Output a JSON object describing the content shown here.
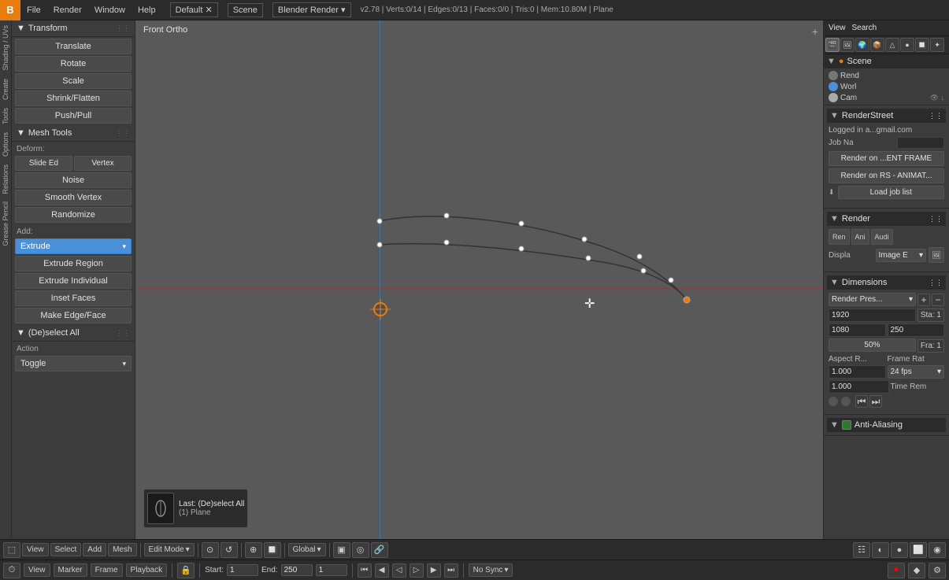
{
  "topbar": {
    "logo": "B",
    "menus": [
      "File",
      "Render",
      "Window",
      "Help"
    ],
    "workspace_label": "Default",
    "scene_label": "Scene",
    "renderer_label": "Blender Render",
    "info": "v2.78 | Verts:0/14 | Edges:0/13 | Faces:0/0 | Tris:0 | Mem:10.80M | Plane"
  },
  "viewport": {
    "label": "Front Ortho"
  },
  "left_sidebar": {
    "transform_header": "Transform",
    "transform_buttons": [
      "Translate",
      "Rotate",
      "Scale",
      "Shrink/Flatten",
      "Push/Pull"
    ],
    "mesh_tools_header": "Mesh Tools",
    "deform_label": "Deform:",
    "deform_buttons_row": [
      "Slide Ed",
      "Vertex"
    ],
    "noise_btn": "Noise",
    "smooth_vertex_btn": "Smooth Vertex",
    "randomize_btn": "Randomize",
    "add_label": "Add:",
    "extrude_dropdown": "Extrude",
    "extrude_region_btn": "Extrude Region",
    "extrude_individual_btn": "Extrude Individual",
    "inset_faces_btn": "Inset Faces",
    "make_edge_btn": "Make Edge/Face",
    "deselect_header": "(De)select All",
    "action_label": "Action",
    "toggle_dropdown": "Toggle"
  },
  "edge_tabs": [
    "Shading / UVs",
    "Create",
    "Tools",
    "Options",
    "Relations",
    "Grease Pencil"
  ],
  "right_panel": {
    "view_label": "View",
    "search_label": "Search",
    "scene_header": "Scene",
    "scene_icon": "●",
    "outliner_items": [
      {
        "name": "Rend",
        "type": "render"
      },
      {
        "name": "Worl",
        "type": "world"
      },
      {
        "name": "Cam",
        "type": "camera"
      }
    ],
    "renderstreet_header": "RenderStreet",
    "logged_in": "Logged in a...gmail.com",
    "job_na_label": "Job Na",
    "render_ent_frame_btn": "Render on ...ENT FRAME",
    "render_rs_anim_btn": "Render on RS - ANIMAT...",
    "load_job_list_btn": "Load job list",
    "render_header": "Render",
    "render_tabs": [
      "Ren",
      "Ani",
      "Audi"
    ],
    "display_label": "Displa",
    "display_dropdown": "Image E",
    "dimensions_header": "Dimensions",
    "render_pres_btn": "Render Pres...",
    "resolution_x": "1920",
    "resolution_y": "1080",
    "resolution_pct": "50%",
    "sta_label": "Sta: 1",
    "end_label": "250",
    "fra_label": "Fra: 1",
    "aspect_r_label": "Aspect R...",
    "aspect_x": "1.000",
    "aspect_y": "1.000",
    "frame_rat_label": "Frame Rat",
    "frame_rat_val": "24 fps",
    "time_rem_label": "Time Rem",
    "aa_header": "Anti-Aliasing",
    "aa_checkbox": true
  },
  "bottom_toolbar": {
    "view_label": "View",
    "select_label": "Select",
    "add_label": "Add",
    "mesh_label": "Mesh",
    "mode_dropdown": "Edit Mode",
    "pivot_dropdown": "·",
    "global_dropdown": "Global",
    "icons": [
      "⊕",
      "↺",
      "✎",
      "✦",
      "◉"
    ],
    "sync_dropdown": "No Sync"
  },
  "timeline": {
    "view_label": "View",
    "marker_label": "Marker",
    "frame_label": "Frame",
    "playback_label": "Playback",
    "start_label": "Start:",
    "start_val": "1",
    "end_label": "End:",
    "end_val": "250",
    "current_frame": "1"
  },
  "last_action": {
    "line1": "Last: (De)select All",
    "line2": "(1) Plane"
  }
}
